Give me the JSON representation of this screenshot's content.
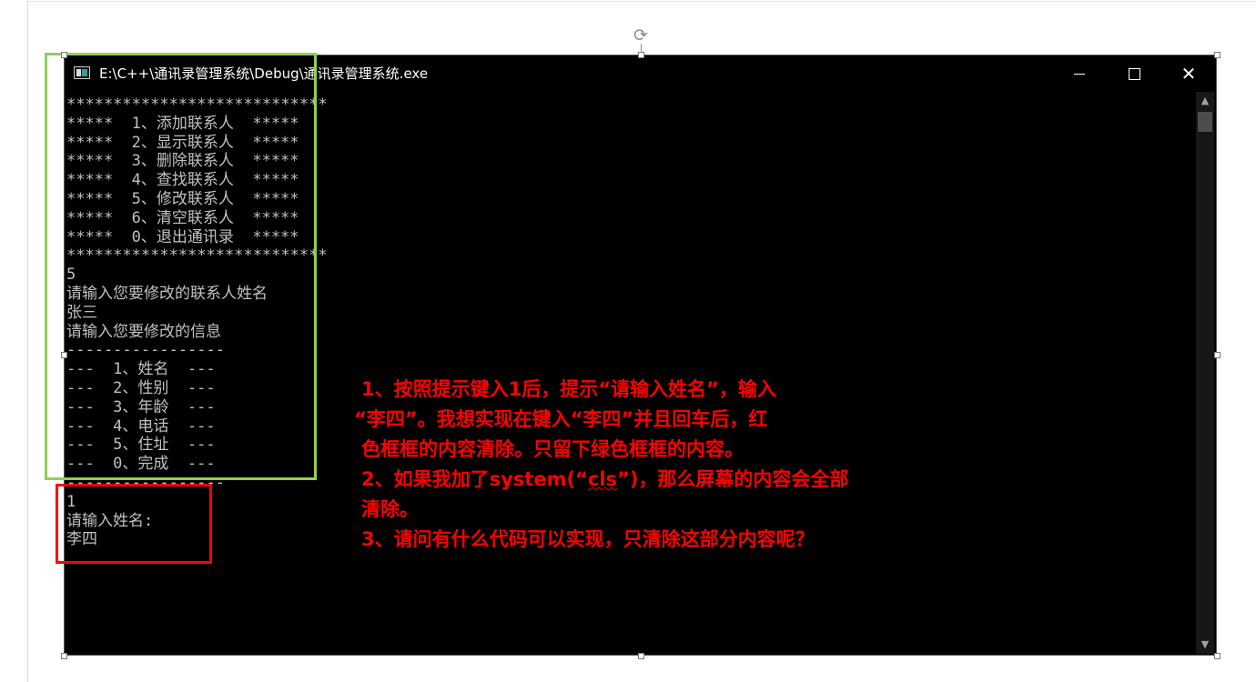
{
  "window": {
    "title": "E:\\C++\\通讯录管理系统\\Debug\\通讯录管理系统.exe",
    "icons": {
      "app": "console-app-icon",
      "minimize": "minimize-icon",
      "maximize": "maximize-icon",
      "close": "close-icon",
      "rotate": "rotate-handle-icon"
    }
  },
  "console": {
    "lines": [
      "****************************",
      "*****  1、添加联系人  *****",
      "*****  2、显示联系人  *****",
      "*****  3、删除联系人  *****",
      "*****  4、查找联系人  *****",
      "*****  5、修改联系人  *****",
      "*****  6、清空联系人  *****",
      "*****  0、退出通讯录  *****",
      "****************************",
      "5",
      "请输入您要修改的联系人姓名",
      "张三",
      "请输入您要修改的信息",
      "-----------------",
      "---  1、姓名  ---",
      "---  2、性别  ---",
      "---  3、年龄  ---",
      "---  4、电话  ---",
      "---  5、住址  ---",
      "---  0、完成  ---",
      "-----------------",
      "1",
      "请输入姓名:",
      "李四"
    ]
  },
  "annotation": {
    "line1": "1、按照提示键入1后，提示“请输入姓名”，输入",
    "line2": "“李四”。我想实现在键入“李四”并且回车后，红",
    "line3": "色框框的内容清除。只留下绿色框框的内容。",
    "line4_before": "2、如果我加了system(“",
    "line4_underlined": "cls",
    "line4_after": "”)，那么屏幕的内容会全部",
    "line5": "清除。",
    "line6": "3、请问有什么代码可以实现，只清除这部分内容呢？"
  },
  "colors": {
    "console_bg": "#000000",
    "console_text": "#c0c0c0",
    "annotation": "#ff0000",
    "green_box": "#92d050",
    "red_box": "#ff0000"
  }
}
